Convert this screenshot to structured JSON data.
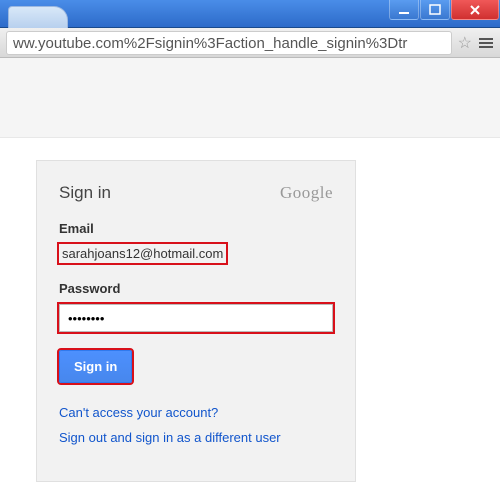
{
  "browser": {
    "url": "ww.youtube.com%2Fsignin%3Faction_handle_signin%3Dtr"
  },
  "signin": {
    "title": "Sign in",
    "brand": "Google",
    "email_label": "Email",
    "email_value": "sarahjoans12@hotmail.com",
    "password_label": "Password",
    "password_value": "••••••••",
    "button_label": "Sign in",
    "link_cant_access": "Can't access your account?",
    "link_signout": "Sign out and sign in as a different user"
  }
}
